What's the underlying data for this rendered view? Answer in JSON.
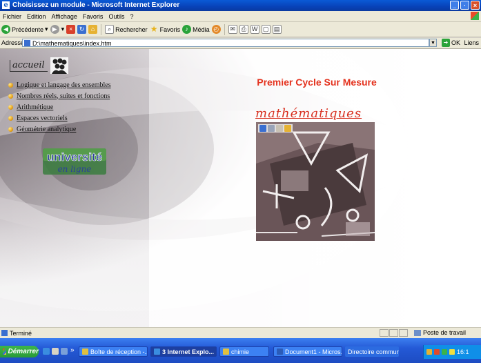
{
  "window": {
    "title": "Choisissez un module - Microsoft Internet Explorer",
    "controls": [
      "_",
      "·",
      "×"
    ]
  },
  "menubar": [
    "Fichier",
    "Edition",
    "Affichage",
    "Favoris",
    "Outils",
    "?"
  ],
  "toolbar": {
    "back": "Précédente",
    "search": "Rechercher",
    "favorites": "Favoris",
    "media": "Média"
  },
  "address": {
    "label": "Adresse",
    "url": "D:\\mathematiques\\index.htm",
    "go": "OK",
    "links": "Liens"
  },
  "page": {
    "accueil": "accueil",
    "menu": [
      "Logique et langage des ensembles",
      "Nombres réels, suites et fonctions",
      "Arithmétique",
      "Espaces vectoriels",
      "Géométrie analytique"
    ],
    "logo_text": "université en ligne",
    "headline": "Premier Cycle Sur Mesure",
    "subject": "mathématiques",
    "colors": {
      "headline": "#e4321e",
      "subject": "#d83020",
      "bullet": "#e6a21a"
    }
  },
  "statusbar": {
    "status": "Terminé",
    "zone": "Poste de travail"
  },
  "taskbar": {
    "start": "Démarrer",
    "chevron": "»",
    "tasks": [
      {
        "label": "Boîte de réception -...",
        "active": false
      },
      {
        "label": "3 Internet Explo...",
        "active": true
      },
      {
        "label": "chimie",
        "active": false
      },
      {
        "label": "Document1 - Micros...",
        "active": false
      },
      {
        "label": "Directoire commun",
        "active": false
      }
    ],
    "clock": "16:1"
  }
}
